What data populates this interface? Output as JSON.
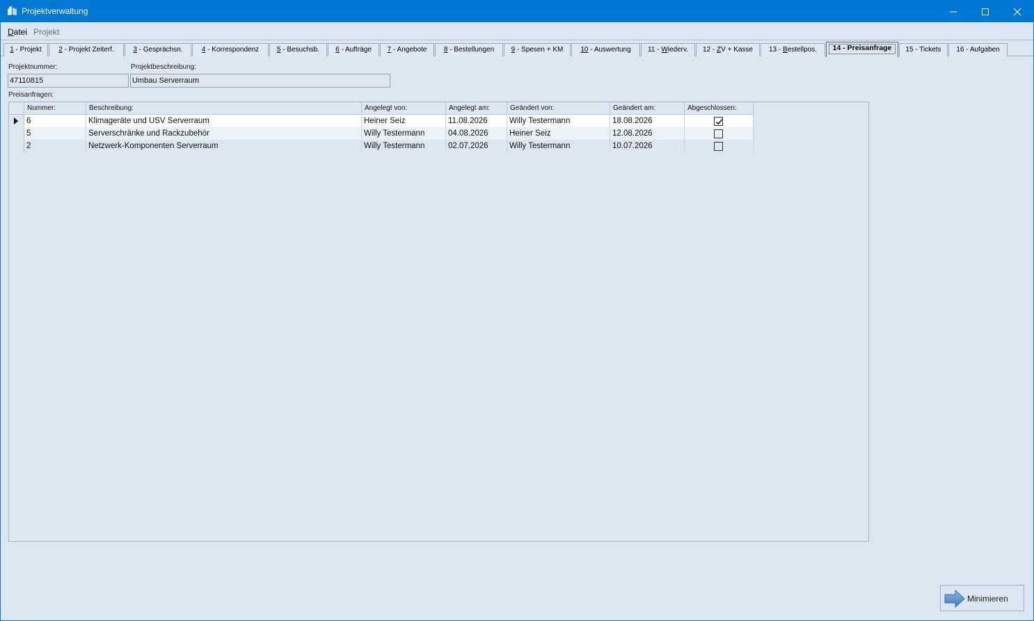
{
  "window": {
    "title": "Projektverwaltung",
    "accent": "#0078d4"
  },
  "menu": {
    "datei_first": "D",
    "datei_rest": "atei",
    "projekt": "Projekt"
  },
  "tabs": [
    {
      "key": "1",
      "label": " - Projekt"
    },
    {
      "key": "2",
      "label": " - Projekt Zeiterf."
    },
    {
      "key": "3",
      "label": " - Gesprächsn."
    },
    {
      "key": "4",
      "label": " - Korrespondenz"
    },
    {
      "key": "5",
      "label": " - Besuchsb."
    },
    {
      "key": "6",
      "label": " - Aufträge"
    },
    {
      "key": "7",
      "label": " - Angebote"
    },
    {
      "key": "8",
      "label": " - Bestellungen"
    },
    {
      "key": "9",
      "label": " - Spesen + KM"
    },
    {
      "key": "10",
      "label": " - Auswertung"
    },
    {
      "prefix": "11 - ",
      "key": "W",
      "label": "iederv."
    },
    {
      "prefix": "12 - ",
      "key": "Z",
      "label": "V + Kasse"
    },
    {
      "prefix": "13 - ",
      "key": "B",
      "label": "estellpos."
    },
    {
      "prefix": "",
      "key": "",
      "label": "14 - Preisanfrage"
    },
    {
      "prefix": "",
      "key": "",
      "label": "15 - Tickets"
    },
    {
      "prefix": "",
      "key": "",
      "label": "16 - Aufgaben"
    }
  ],
  "form": {
    "projektnummer_label": "Projektnummer:",
    "projektnummer_value": "47110815",
    "projektbeschreibung_label": "Projektbeschreibung:",
    "projektbeschreibung_value": "Umbau Serverraum",
    "preisanfragen_label": "Preisanfragen:"
  },
  "grid": {
    "columns": [
      "Nummer:",
      "Beschreibung:",
      "Angelegt von:",
      "Angelegt am:",
      "Geändert von:",
      "Geändert am:",
      "Abgeschlossen:"
    ],
    "rows": [
      {
        "nummer": "6",
        "beschreibung": "Klimageräte und USV Serverraum",
        "angelegt_von": "Heiner Seiz",
        "angelegt_am": "11.08.2026",
        "geaendert_von": "Willy Testermann",
        "geaendert_am": "18.08.2026",
        "abgeschlossen": true
      },
      {
        "nummer": "5",
        "beschreibung": "Serverschränke und Rackzubehör",
        "angelegt_von": "Willy Testermann",
        "angelegt_am": "04.08.2026",
        "geaendert_von": "Heiner Seiz",
        "geaendert_am": "12.08.2026",
        "abgeschlossen": false
      },
      {
        "nummer": "2",
        "beschreibung": "Netzwerk-Komponenten Serverraum",
        "angelegt_von": "Willy Testermann",
        "angelegt_am": "02.07.2026",
        "geaendert_von": "Willy Testermann",
        "geaendert_am": "10.07.2026",
        "abgeschlossen": false
      }
    ]
  },
  "buttons": {
    "minimieren": "Minimieren"
  }
}
